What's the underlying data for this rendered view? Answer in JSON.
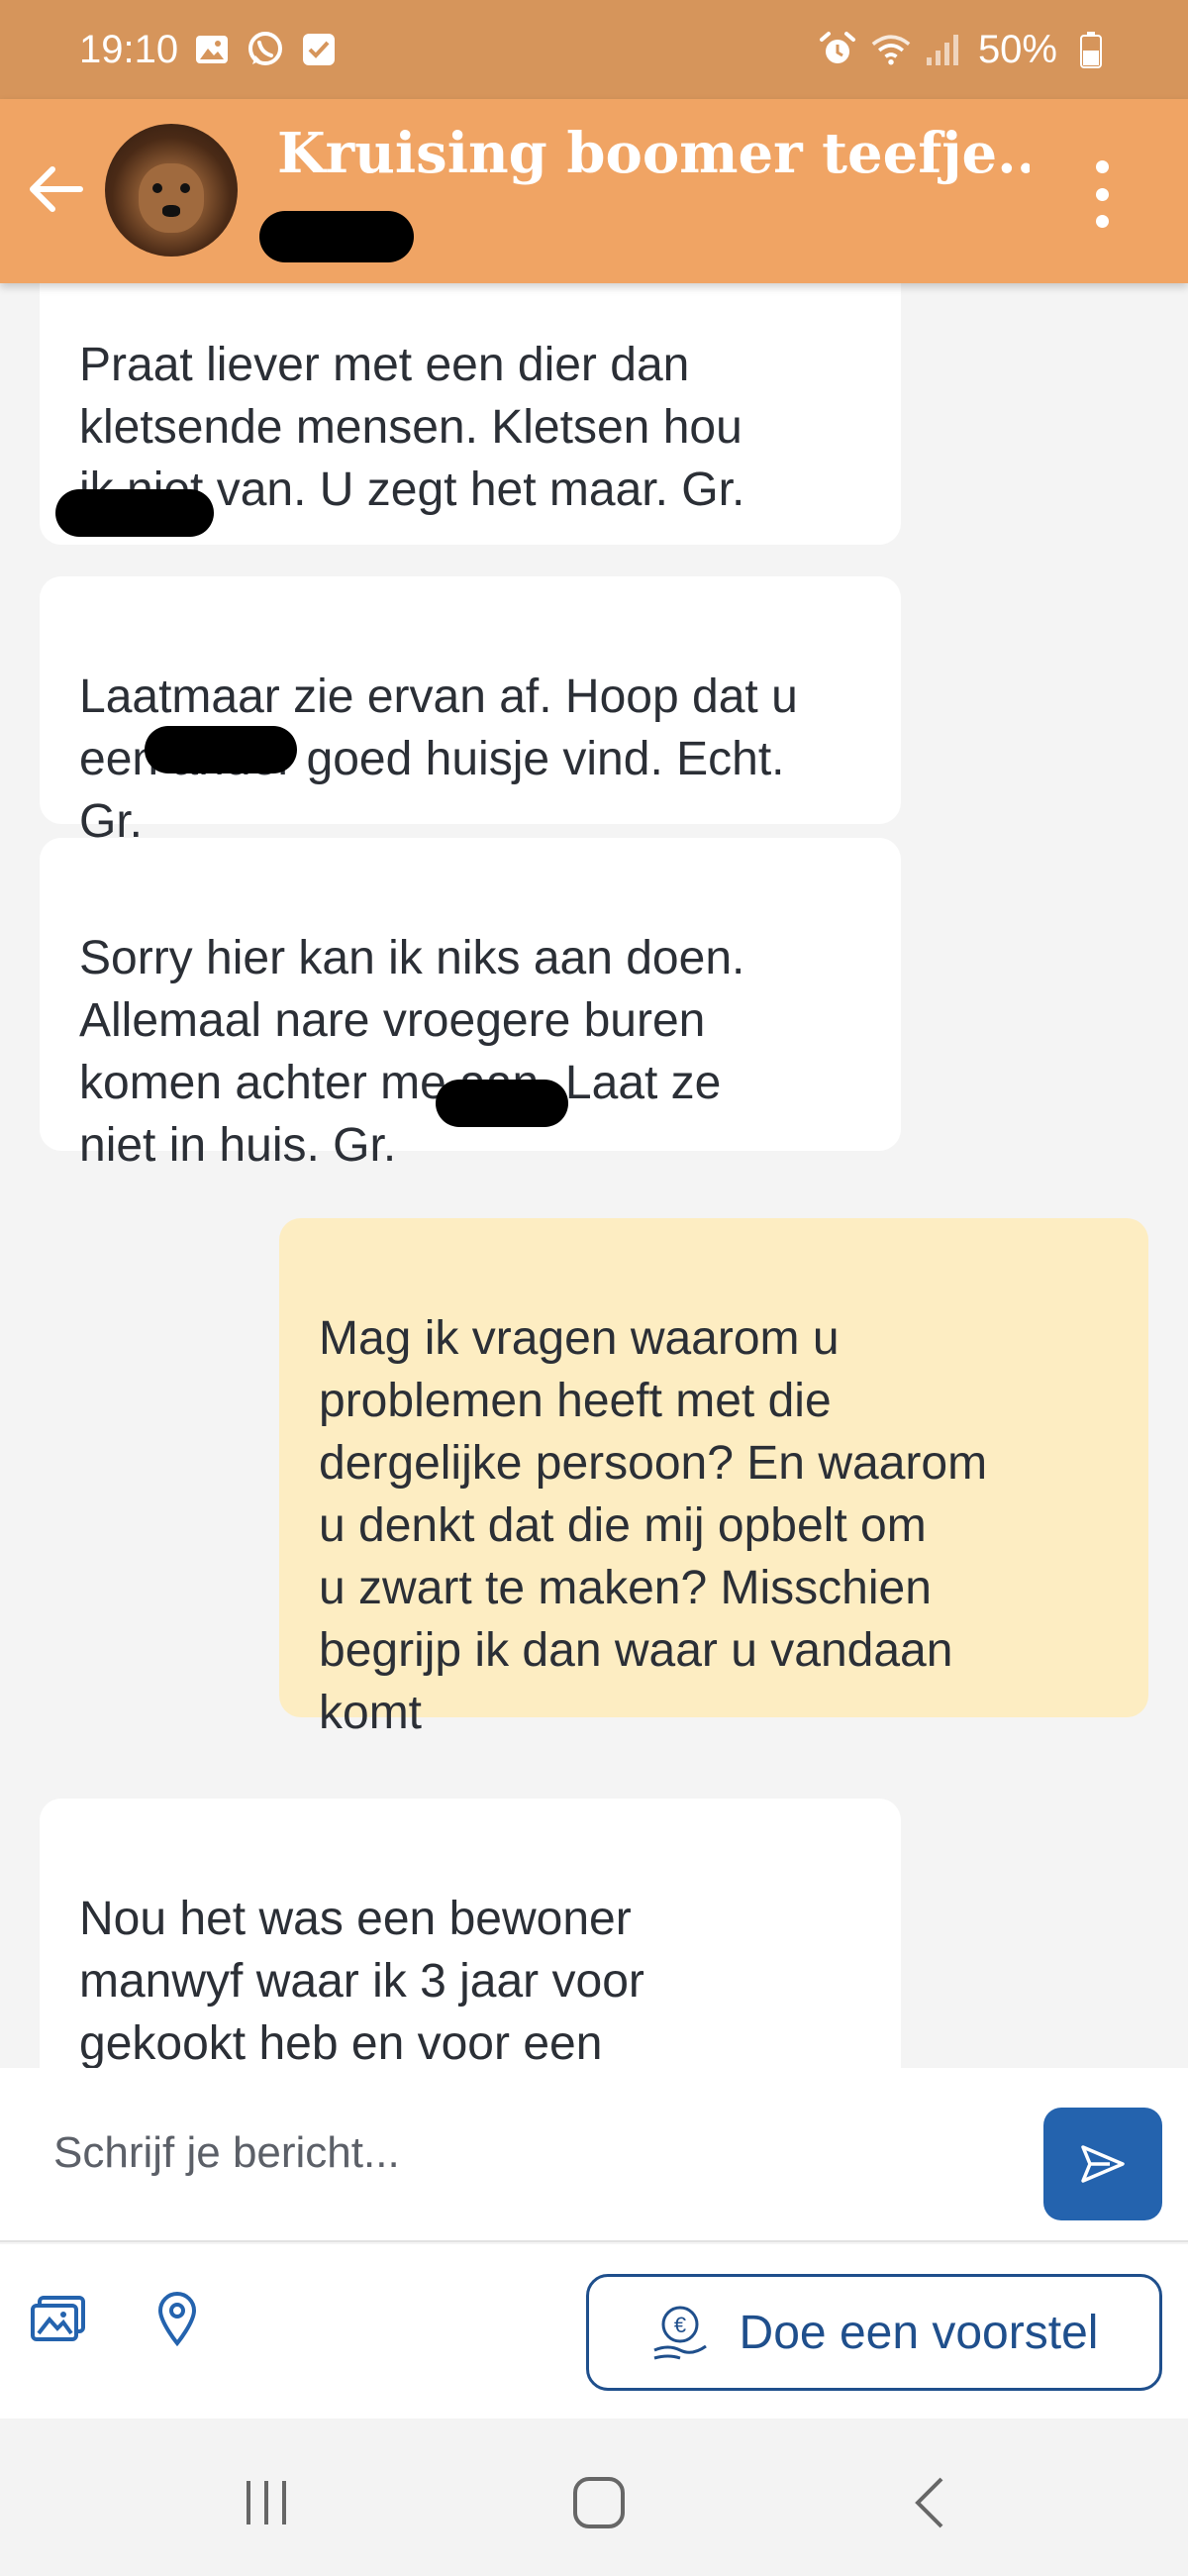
{
  "status_bar": {
    "time": "19:10",
    "battery": "50%",
    "left_icons": [
      "gallery-icon",
      "whatsapp-icon",
      "check-icon"
    ],
    "right_icons": [
      "alarm-icon",
      "wifi-icon",
      "signal-icon",
      "battery-icon"
    ]
  },
  "header": {
    "title": "Kruising boomer teefje...",
    "back_icon": "arrow-left-icon",
    "menu_icon": "more-vertical-icon"
  },
  "messages": [
    {
      "direction": "incoming",
      "text": "Praat liever met een dier dan\nkletsende mensen. Kletsen hou\nik niet van. U zegt het maar. Gr."
    },
    {
      "direction": "incoming",
      "text": "Laatmaar zie ervan af. Hoop dat u\neen ander goed huisje vind. Echt.\nGr."
    },
    {
      "direction": "incoming",
      "text": "Sorry hier kan ik niks aan doen.\nAllemaal nare vroegere buren\nkomen achter me aan. Laat ze\nniet in huis. Gr."
    },
    {
      "direction": "outgoing",
      "text": "Mag ik vragen waarom u\nproblemen heeft met die\ndergelijke persoon? En waarom\nu denkt dat die mij opbelt om\nu zwart te maken? Misschien\nbegrijp ik dan waar u vandaan\nkomt"
    },
    {
      "direction": "incoming",
      "text": "Nou het was een bewoner\nmanwyf waar ik 3 jaar voor\ngekookt heb en voor een\nvrouw.  Ik wilde alleen wonen"
    }
  ],
  "composer": {
    "placeholder": "Schrijf je bericht...",
    "send_icon": "send-icon"
  },
  "actions": {
    "photo_icon": "photos-icon",
    "location_icon": "location-pin-icon",
    "offer_label": "Doe een voorstel",
    "offer_icon": "euro-hand-icon"
  },
  "colors": {
    "status_bar": "#d6955b",
    "header": "#f0a464",
    "outgoing_bubble": "#fdedc2",
    "incoming_bubble": "#ffffff",
    "accent_blue": "#2463ae"
  },
  "navbar": {
    "icons": [
      "recent-apps-icon",
      "home-icon",
      "back-icon"
    ]
  }
}
